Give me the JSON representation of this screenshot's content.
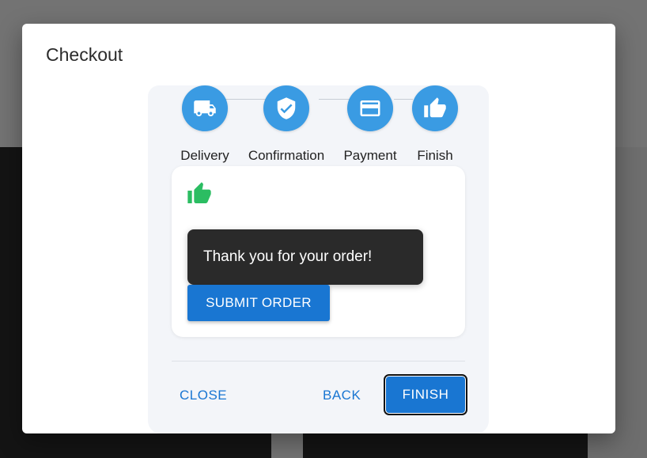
{
  "dialog": {
    "title": "Checkout"
  },
  "stepper": {
    "steps": [
      {
        "label": "Delivery",
        "icon": "truck-icon"
      },
      {
        "label": "Confirmation",
        "icon": "verified-shield-icon"
      },
      {
        "label": "Payment",
        "icon": "credit-card-icon"
      },
      {
        "label": "Finish",
        "icon": "thumb-up-icon"
      }
    ],
    "active_color": "#3a9be3"
  },
  "content": {
    "success_icon": "thumb-up-icon",
    "success_icon_color": "#2bbd62",
    "toast_message": "Thank you for your order!",
    "submit_label": "SUBMIT ORDER"
  },
  "actions": {
    "close_label": "CLOSE",
    "back_label": "BACK",
    "finish_label": "FINISH"
  },
  "colors": {
    "primary": "#1976d2",
    "toast_bg": "#2a2a2a"
  }
}
